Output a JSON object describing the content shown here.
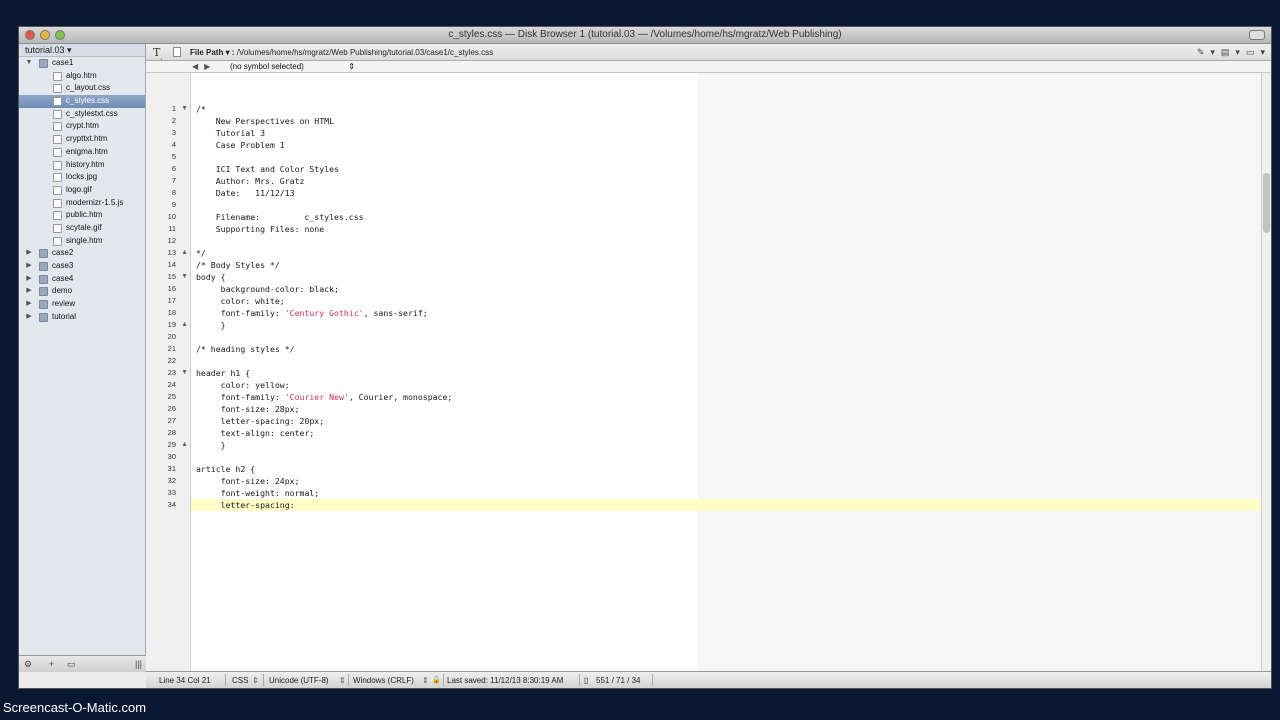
{
  "window": {
    "title": "c_styles.css — Disk Browser 1 (tutorial.03 — /Volumes/home/hs/mgratz/Web Publishing)"
  },
  "sidebar": {
    "root_label": "tutorial.03",
    "tree": [
      {
        "label": "case1",
        "kind": "folder",
        "depth": 0,
        "open": true
      },
      {
        "label": "algo.htm",
        "kind": "file",
        "depth": 1
      },
      {
        "label": "c_layout.css",
        "kind": "file",
        "depth": 1
      },
      {
        "label": "c_styles.css",
        "kind": "file",
        "depth": 1,
        "selected": true
      },
      {
        "label": "c_stylestxt.css",
        "kind": "file",
        "depth": 1
      },
      {
        "label": "crypt.htm",
        "kind": "file",
        "depth": 1
      },
      {
        "label": "crypttxt.htm",
        "kind": "file",
        "depth": 1
      },
      {
        "label": "enigma.htm",
        "kind": "file",
        "depth": 1
      },
      {
        "label": "history.htm",
        "kind": "file",
        "depth": 1
      },
      {
        "label": "locks.jpg",
        "kind": "file",
        "depth": 1
      },
      {
        "label": "logo.gif",
        "kind": "file",
        "depth": 1
      },
      {
        "label": "modernizr-1.5.js",
        "kind": "file",
        "depth": 1
      },
      {
        "label": "public.htm",
        "kind": "file",
        "depth": 1
      },
      {
        "label": "scytale.gif",
        "kind": "file",
        "depth": 1
      },
      {
        "label": "single.htm",
        "kind": "file",
        "depth": 1
      },
      {
        "label": "case2",
        "kind": "folder",
        "depth": 0
      },
      {
        "label": "case3",
        "kind": "folder",
        "depth": 0
      },
      {
        "label": "case4",
        "kind": "folder",
        "depth": 0
      },
      {
        "label": "demo",
        "kind": "folder",
        "depth": 0
      },
      {
        "label": "review",
        "kind": "folder",
        "depth": 0
      },
      {
        "label": "tutorial",
        "kind": "folder",
        "depth": 0
      }
    ],
    "footer": {
      "gear": "⚙",
      "add": "+",
      "view": "▭",
      "grip": "|||"
    }
  },
  "navbar": {
    "file_path_label": "File Path ▾ :",
    "file_path": "/Volumes/home/hs/mgratz/Web Publishing/tutorial.03/case1/c_styles.css",
    "tools": [
      "✎",
      "▾",
      "▤",
      "▾",
      "▭",
      "▾"
    ]
  },
  "symbolbar": {
    "back": "◀",
    "forward": "▶",
    "symbol": "(no symbol selected)",
    "stepper": "⇕"
  },
  "editor": {
    "current_line": 34,
    "lines": [
      {
        "n": 1,
        "text": "/*",
        "fold": "▼"
      },
      {
        "n": 2,
        "text": "    New Perspectives on HTML"
      },
      {
        "n": 3,
        "text": "    Tutorial 3"
      },
      {
        "n": 4,
        "text": "    Case Problem 1"
      },
      {
        "n": 5,
        "text": ""
      },
      {
        "n": 6,
        "text": "    ICI Text and Color Styles"
      },
      {
        "n": 7,
        "text": "    Author: Mrs. Gratz"
      },
      {
        "n": 8,
        "text": "    Date:   11/12/13"
      },
      {
        "n": 9,
        "text": ""
      },
      {
        "n": 10,
        "text": "    Filename:         c_styles.css"
      },
      {
        "n": 11,
        "text": "    Supporting Files: none"
      },
      {
        "n": 12,
        "text": ""
      },
      {
        "n": 13,
        "text": "*/",
        "fold": "▲"
      },
      {
        "n": 14,
        "text": "/* Body Styles */"
      },
      {
        "n": 15,
        "text": "body {",
        "fold": "▼"
      },
      {
        "n": 16,
        "text": "     background-color: black;"
      },
      {
        "n": 17,
        "text": "     color: white;"
      },
      {
        "n": 18,
        "pre": "     font-family: ",
        "str": "'Century Gothic'",
        "post": ", sans-serif;"
      },
      {
        "n": 19,
        "text": "     }",
        "fold": "▲"
      },
      {
        "n": 20,
        "text": ""
      },
      {
        "n": 21,
        "text": "/* heading styles */"
      },
      {
        "n": 22,
        "text": ""
      },
      {
        "n": 23,
        "text": "header h1 {",
        "fold": "▼"
      },
      {
        "n": 24,
        "text": "     color: yellow;"
      },
      {
        "n": 25,
        "pre": "     font-family: ",
        "str": "'Courier New'",
        "post": ", Courier, monospace;"
      },
      {
        "n": 26,
        "text": "     font-size: 28px;"
      },
      {
        "n": 27,
        "text": "     letter-spacing: 20px;"
      },
      {
        "n": 28,
        "text": "     text-align: center;"
      },
      {
        "n": 29,
        "text": "     }",
        "fold": "▲"
      },
      {
        "n": 30,
        "text": ""
      },
      {
        "n": 31,
        "text": "article h2 {"
      },
      {
        "n": 32,
        "text": "     font-size: 24px;"
      },
      {
        "n": 33,
        "text": "     font-weight: normal;"
      },
      {
        "n": 34,
        "text": "     letter-spacing:"
      }
    ]
  },
  "statusbar": {
    "position": "Line 34 Col 21",
    "language": "CSS",
    "encoding": "Unicode (UTF-8)",
    "line_endings": "Windows (CRLF)",
    "lock": "🔓",
    "last_saved": "Last saved: 11/12/13 8:30:19 AM",
    "counts": "551 / 71 / 34"
  },
  "watermark": "Screencast-O-Matic.com",
  "colors": {
    "selection": "#7a94bd",
    "current_line": "#fffcc6",
    "string": "#c8365a"
  }
}
